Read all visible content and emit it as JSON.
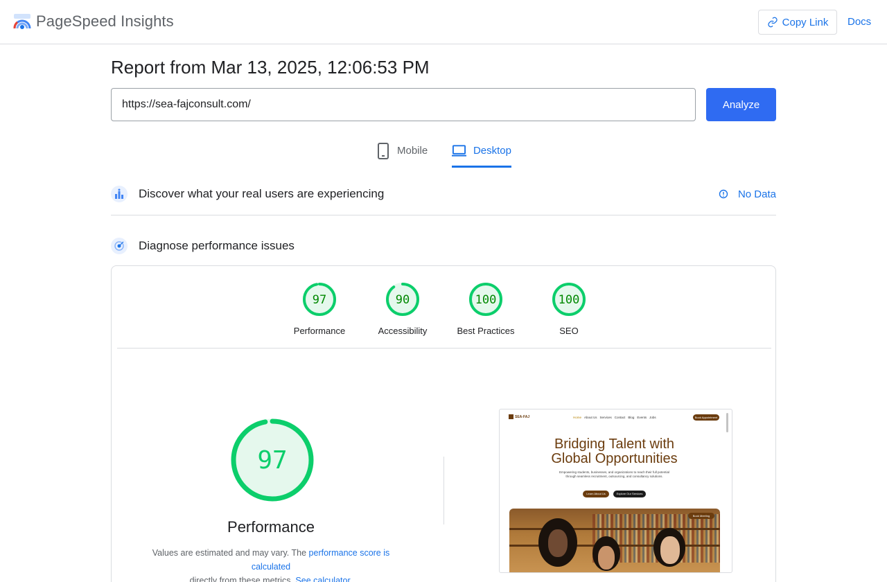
{
  "header": {
    "brand": "PageSpeed Insights",
    "copy_link_label": "Copy Link",
    "docs_label": "Docs"
  },
  "report": {
    "title": "Report from Mar 13, 2025, 12:06:53 PM",
    "url_value": "https://sea-fajconsult.com/",
    "analyze_label": "Analyze"
  },
  "tabs": [
    {
      "label": "Mobile",
      "icon": "phone-icon",
      "active": false
    },
    {
      "label": "Desktop",
      "icon": "laptop-icon",
      "active": true
    }
  ],
  "sections": {
    "real_users": {
      "title": "Discover what your real users are experiencing",
      "status": "No Data"
    },
    "diagnose": {
      "title": "Diagnose performance issues"
    }
  },
  "scores": [
    {
      "label": "Performance",
      "value": "97"
    },
    {
      "label": "Accessibility",
      "value": "90"
    },
    {
      "label": "Best Practices",
      "value": "100"
    },
    {
      "label": "SEO",
      "value": "100"
    }
  ],
  "performance": {
    "score": "97",
    "title": "Performance",
    "note_prefix": "Values are estimated and may vary. The ",
    "note_link1": "performance score is calculated",
    "note_middle": " directly from these metrics. ",
    "note_link2": "See calculator."
  },
  "preview": {
    "logo": "SEA-FAJ",
    "nav": [
      "Home",
      "About Us",
      "Services",
      "Contact",
      "Blog",
      "Events",
      "Jobs"
    ],
    "top_button": "Book Appointment",
    "headline_line1": "Bridging Talent with",
    "headline_line2": "Global Opportunities",
    "subtext": "Empowering students, businesses, and organizations to reach their full potential through seamless recruitment, outsourcing, and consultancy solutions.",
    "button1": "Learn About Us",
    "button2": "Explore Our Services",
    "image_tag": "Book Meeting"
  },
  "colors": {
    "accent": "#1a73e8",
    "analyze_button": "#2f6bf2",
    "gauge_good": "#0cce6b",
    "gauge_good_text": "#008800",
    "gauge_fill": "#e5f8ed",
    "brand_brown": "#6b3c0e"
  }
}
